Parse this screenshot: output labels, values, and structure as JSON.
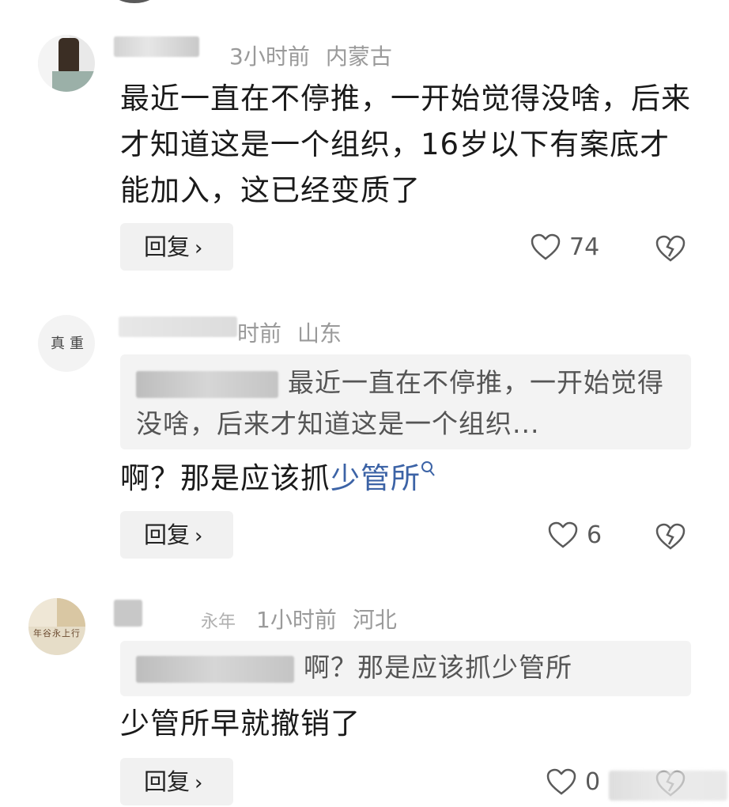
{
  "comments": [
    {
      "time": "3小时前",
      "location": "内蒙古",
      "text": "最近一直在不停推，一开始觉得没啥，后来才知道这是一个组织，16岁以下有案底才能加入，这已经变质了",
      "reply_label": "回复",
      "likes": "74"
    },
    {
      "time_partial": "时前",
      "location": "山东",
      "quote_text": "最近一直在不停推，一开始觉得没啥，后来才知道这是一个组织...",
      "text": "啊？那是应该抓",
      "link_text": "少管所",
      "reply_label": "回复",
      "likes": "6"
    },
    {
      "name_partial": "永年",
      "time": "1小时前",
      "location": "河北",
      "quote_text": "啊？那是应该抓少管所",
      "text": "少管所早就撤销了",
      "reply_label": "回复",
      "likes": "0"
    }
  ],
  "icons": {
    "like": "heart-outline-icon",
    "dislike": "broken-heart-icon",
    "chevron": "chevron-right-icon",
    "search": "search-icon"
  },
  "colors": {
    "link": "#3c63a6",
    "meta": "#9a9a9a",
    "button_bg": "#f1f1f1",
    "quote_bg": "#f3f3f3"
  }
}
